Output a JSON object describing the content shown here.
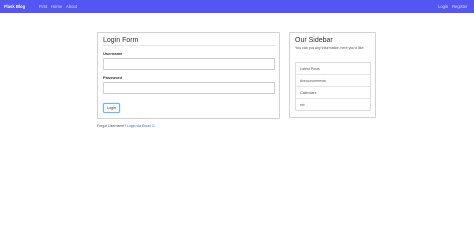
{
  "navbar": {
    "brand": "Flask Blog",
    "links": [
      "First",
      "Home",
      "About"
    ],
    "right_links": [
      "Login",
      "Register"
    ],
    "color": "#5356f0"
  },
  "login_form": {
    "title": "Login Form",
    "username_label": "Username",
    "username_value": "",
    "password_label": "Password",
    "password_value": "",
    "submit_label": "Login",
    "forgot_text": "Forgot Username?",
    "email_link": "Login via Email ☑"
  },
  "sidebar": {
    "title": "Our Sidebar",
    "description": "You can put any information here you'd like.",
    "items": [
      "Latest Posts",
      "Announcements",
      "Calendars",
      "etc"
    ]
  }
}
